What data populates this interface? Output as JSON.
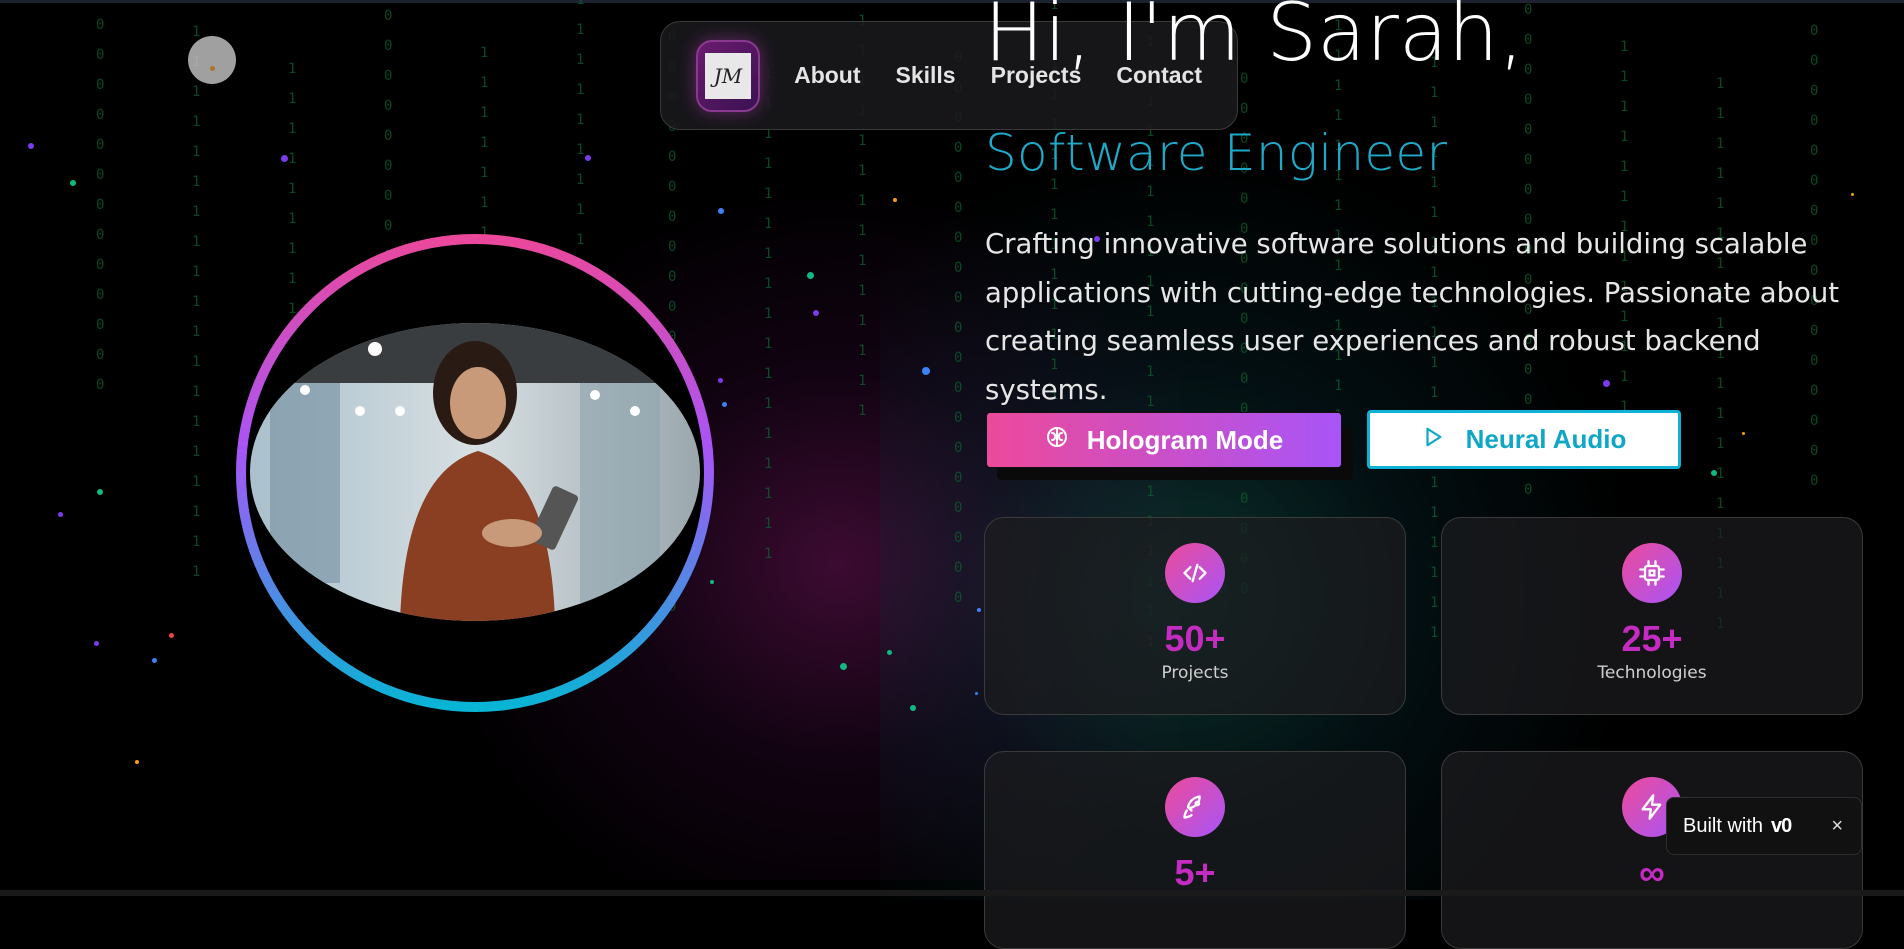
{
  "nav": {
    "logo_text": "JM",
    "links": [
      "About",
      "Skills",
      "Projects",
      "Contact"
    ]
  },
  "hero": {
    "greeting": "Hi, I'm Sarah,",
    "role": "Software Engineer",
    "bio": "Crafting innovative software solutions and building scalable applications with cutting-edge technologies. Passionate about creating seamless user experiences and robust backend systems.",
    "buttons": {
      "hologram": "Hologram Mode",
      "neural": "Neural Audio"
    }
  },
  "stats": [
    {
      "value": "50+",
      "label": "Projects",
      "icon": "code-icon"
    },
    {
      "value": "25+",
      "label": "Technologies",
      "icon": "cpu-icon"
    },
    {
      "value": "5+",
      "label": "",
      "icon": "rocket-icon"
    },
    {
      "value": "∞",
      "label": "",
      "icon": "lightning-icon"
    }
  ],
  "badge": {
    "text": "Built with",
    "mark": "v0",
    "close": "×"
  },
  "colors": {
    "accent_pink": "#ec4899",
    "accent_purple": "#a855f7",
    "accent_cyan": "#06b6d4",
    "stat_number": "#c42bc0"
  }
}
